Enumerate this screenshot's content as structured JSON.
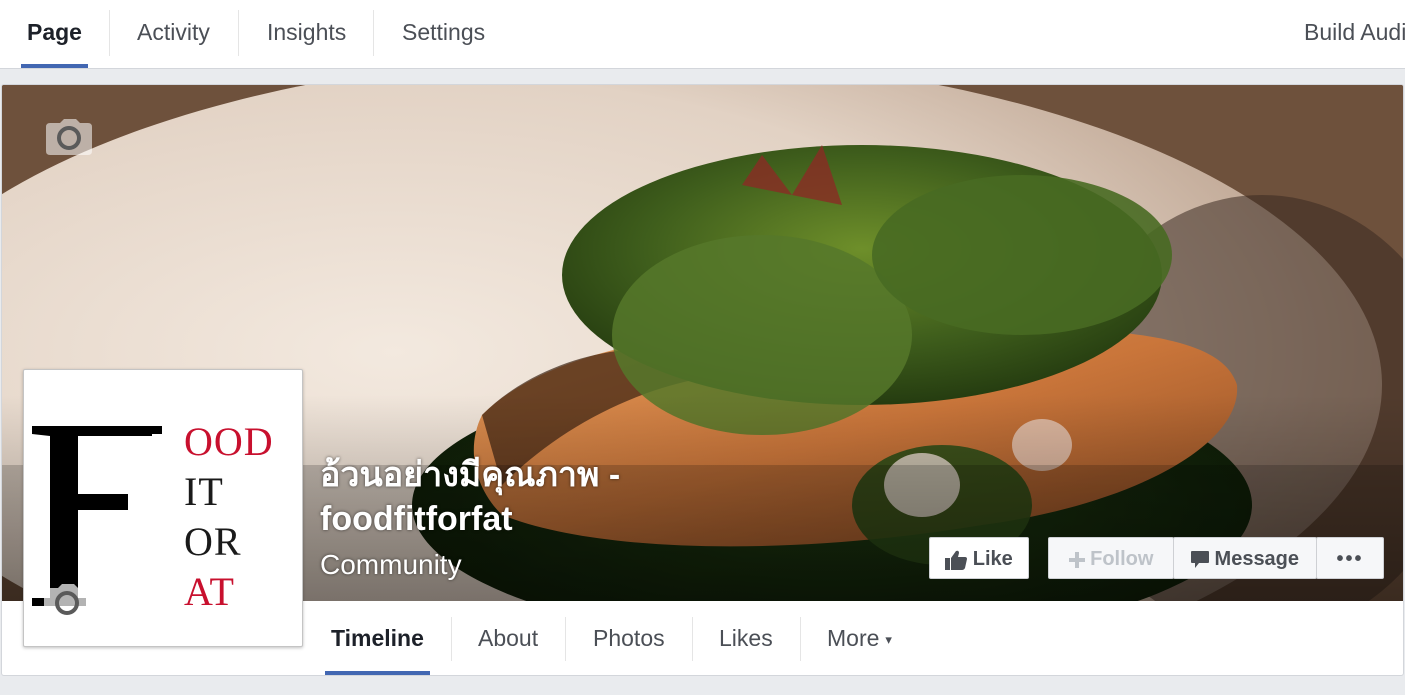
{
  "admin_nav": {
    "tabs": [
      {
        "label": "Page"
      },
      {
        "label": "Activity"
      },
      {
        "label": "Insights"
      },
      {
        "label": "Settings"
      }
    ],
    "active_tab": "Page",
    "build_audience_label": "Build Audi"
  },
  "page": {
    "title": "อ้วนอย่างมีคุณภาพ - foodfitforfat",
    "category": "Community"
  },
  "logo": {
    "big_letter": "F",
    "words": [
      "OOD",
      "IT",
      "OR",
      "AT"
    ]
  },
  "actions": {
    "like_label": "Like",
    "follow_label": "Follow",
    "message_label": "Message",
    "more_label": "•••"
  },
  "page_tabs": {
    "items": [
      {
        "label": "Timeline"
      },
      {
        "label": "About"
      },
      {
        "label": "Photos"
      },
      {
        "label": "Likes"
      },
      {
        "label": "More"
      }
    ],
    "active": "Timeline",
    "more_caret": "▾"
  },
  "colors": {
    "accent": "#4267b2",
    "logo_red": "#c8102e"
  }
}
